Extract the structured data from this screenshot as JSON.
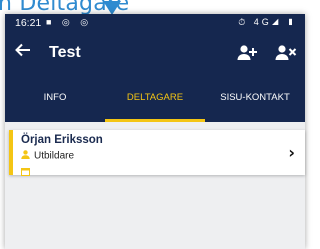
{
  "caption": {
    "text": "n Deltagare"
  },
  "status_bar": {
    "time": "16:21",
    "left_icons": "■ ◎ ◎",
    "right_icons": "⏱ 4G◢ ▮"
  },
  "app_bar": {
    "title": "Test",
    "back_icon": "arrow-left-icon",
    "add_icon": "person-add-icon",
    "remove_icon": "person-remove-icon"
  },
  "tabs": [
    {
      "label": "INFO",
      "active": false
    },
    {
      "label": "DELTAGARE",
      "active": true
    },
    {
      "label": "SISU-KONTAKT",
      "active": false
    }
  ],
  "participants": [
    {
      "name": "Örjan Eriksson",
      "role": "Utbildare"
    }
  ],
  "colors": {
    "primary": "#15274f",
    "accent": "#f4c514",
    "caption": "#2f8bd0"
  }
}
